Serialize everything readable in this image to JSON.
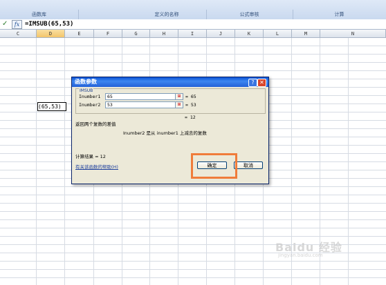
{
  "ribbon": {
    "groups": [
      "函数库",
      "定义的名称",
      "公式审核",
      "计算"
    ]
  },
  "formula_bar": {
    "icons": [
      "checkmark-icon",
      "fx-icon"
    ],
    "fx_label": "fx",
    "formula": "=IMSUB(65,53)"
  },
  "sheet": {
    "columns": [
      "C",
      "D",
      "E",
      "F",
      "G",
      "H",
      "I",
      "J",
      "K",
      "L",
      "M",
      "N"
    ],
    "selected_column": "D",
    "active_cell_text": "(65,53)"
  },
  "dialog": {
    "title": "函数参数",
    "help_glyph": "?",
    "close_glyph": "✕",
    "function_name": "IMSUB",
    "args": [
      {
        "label": "Inumber1",
        "value": "65",
        "result": "= 65"
      },
      {
        "label": "Inumber2",
        "value": "53",
        "result": "= 53"
      }
    ],
    "overall_result": "= 12",
    "description": "返回两个复数的差值",
    "arg_description": "Inumber2  是从 inumber1 上减去的复数",
    "calc_result": "计算结果 = 12",
    "help_link": "有关该函数的帮助(H)",
    "ok_label": "确定",
    "cancel_label": "取消",
    "ref_button_glyph": "⊞"
  },
  "watermark": {
    "brand": "Baidu 经验",
    "sub": "jingyan.baidu.com"
  },
  "colors": {
    "highlight": "#f07c3a",
    "title_bar": "#2461d8",
    "dialog_bg": "#ece9d8"
  }
}
